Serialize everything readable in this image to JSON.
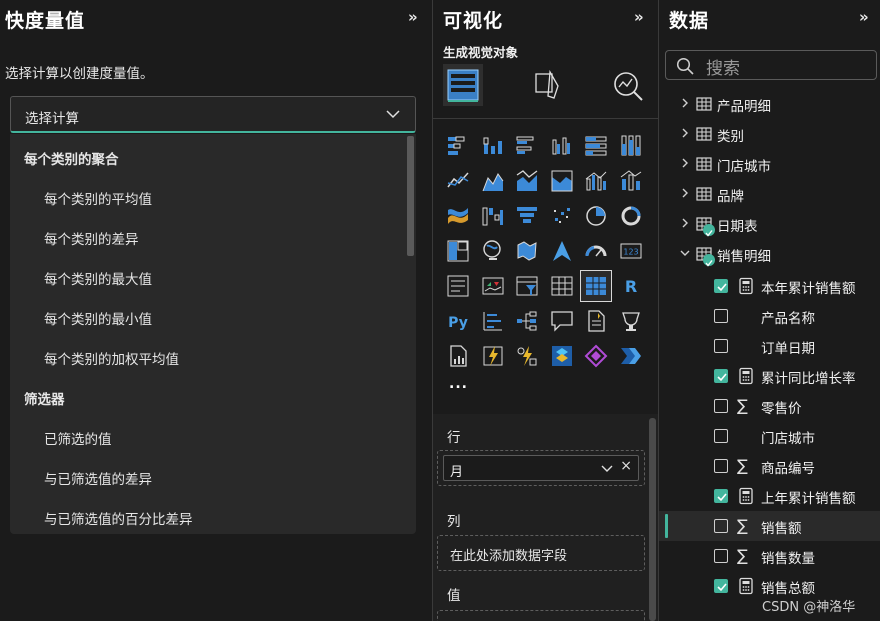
{
  "quick_measure": {
    "title": "快度量值",
    "collapse_glyph": "»",
    "subtitle": "选择计算以创建度量值。",
    "select_value": "选择计算",
    "groups": [
      {
        "label": "每个类别的聚合",
        "items": [
          "每个类别的平均值",
          "每个类别的差异",
          "每个类别的最大值",
          "每个类别的最小值",
          "每个类别的加权平均值"
        ]
      },
      {
        "label": "筛选器",
        "items": [
          "已筛选的值",
          "与已筛选值的差异",
          "与已筛选值的百分比差异"
        ]
      }
    ]
  },
  "visualizations": {
    "title": "可视化",
    "collapse_glyph": "»",
    "build_label": "生成视觉对象",
    "tabs": [
      "build-visual-icon",
      "format-visual-icon",
      "analytics-icon"
    ],
    "icons": [
      "stacked-bar-icon",
      "stacked-column-icon",
      "clustered-bar-icon",
      "clustered-column-icon",
      "100-stacked-bar-icon",
      "100-stacked-column-icon",
      "line-chart-icon",
      "area-chart-icon",
      "stacked-area-icon",
      "ribbon-area-icon",
      "line-clustered-column-icon",
      "line-stacked-column-icon",
      "ribbon-chart-icon",
      "waterfall-icon",
      "funnel-icon",
      "scatter-icon",
      "pie-icon",
      "donut-icon",
      "treemap-icon",
      "map-icon",
      "filled-map-icon",
      "azure-map-icon",
      "gauge-icon",
      "card-icon",
      "multi-row-card-icon",
      "kpi-icon",
      "slicer-icon",
      "table-icon",
      "matrix-icon",
      "r-visual-icon",
      "python-visual-icon",
      "key-influencers-icon",
      "decomposition-tree-icon",
      "qa-icon",
      "smart-narrative-icon",
      "metrics-icon",
      "paginated-report-icon",
      "arcgis-icon",
      "powerapps-icon",
      "power-automate-icon",
      "visio-icon",
      "more-icon"
    ],
    "selected_icon": "matrix-icon",
    "more_label": "...",
    "wells": {
      "rows": {
        "label": "行",
        "field": "月",
        "remove_glyph": "×"
      },
      "columns": {
        "label": "列",
        "placeholder": "在此处添加数据字段"
      },
      "values": {
        "label": "值"
      }
    }
  },
  "data": {
    "title": "数据",
    "collapse_glyph": "»",
    "search_placeholder": "搜索",
    "tables": [
      {
        "name": "产品明细",
        "expanded": false,
        "badge": false
      },
      {
        "name": "类别",
        "expanded": false,
        "badge": false
      },
      {
        "name": "门店城市",
        "expanded": false,
        "badge": false
      },
      {
        "name": "品牌",
        "expanded": false,
        "badge": false
      },
      {
        "name": "日期表",
        "expanded": false,
        "badge": true
      },
      {
        "name": "销售明细",
        "expanded": true,
        "badge": true
      }
    ],
    "fields": [
      {
        "name": "本年累计销售额",
        "checked": true,
        "icon": "calculator-icon",
        "glyph": "▦"
      },
      {
        "name": "产品名称",
        "checked": false,
        "icon": "",
        "glyph": ""
      },
      {
        "name": "订单日期",
        "checked": false,
        "icon": "",
        "glyph": ""
      },
      {
        "name": "累计同比增长率",
        "checked": true,
        "icon": "calculator-icon",
        "glyph": "▦"
      },
      {
        "name": "零售价",
        "checked": false,
        "icon": "sigma-icon",
        "glyph": "∑"
      },
      {
        "name": "门店城市",
        "checked": false,
        "icon": "",
        "glyph": ""
      },
      {
        "name": "商品编号",
        "checked": false,
        "icon": "sigma-icon",
        "glyph": "∑"
      },
      {
        "name": "上年累计销售额",
        "checked": true,
        "icon": "calculator-icon",
        "glyph": "▦"
      },
      {
        "name": "销售额",
        "checked": false,
        "icon": "sigma-icon",
        "glyph": "∑",
        "highlighted": true
      },
      {
        "name": "销售数量",
        "checked": false,
        "icon": "sigma-icon",
        "glyph": "∑"
      },
      {
        "name": "销售总额",
        "checked": true,
        "icon": "calculator-icon",
        "glyph": "▦"
      }
    ]
  },
  "watermark": "CSDN @神洛华",
  "colors": {
    "accent": "#43b59d",
    "bg": "#1b1b1b",
    "chart_blue": "#3c8ad8"
  }
}
